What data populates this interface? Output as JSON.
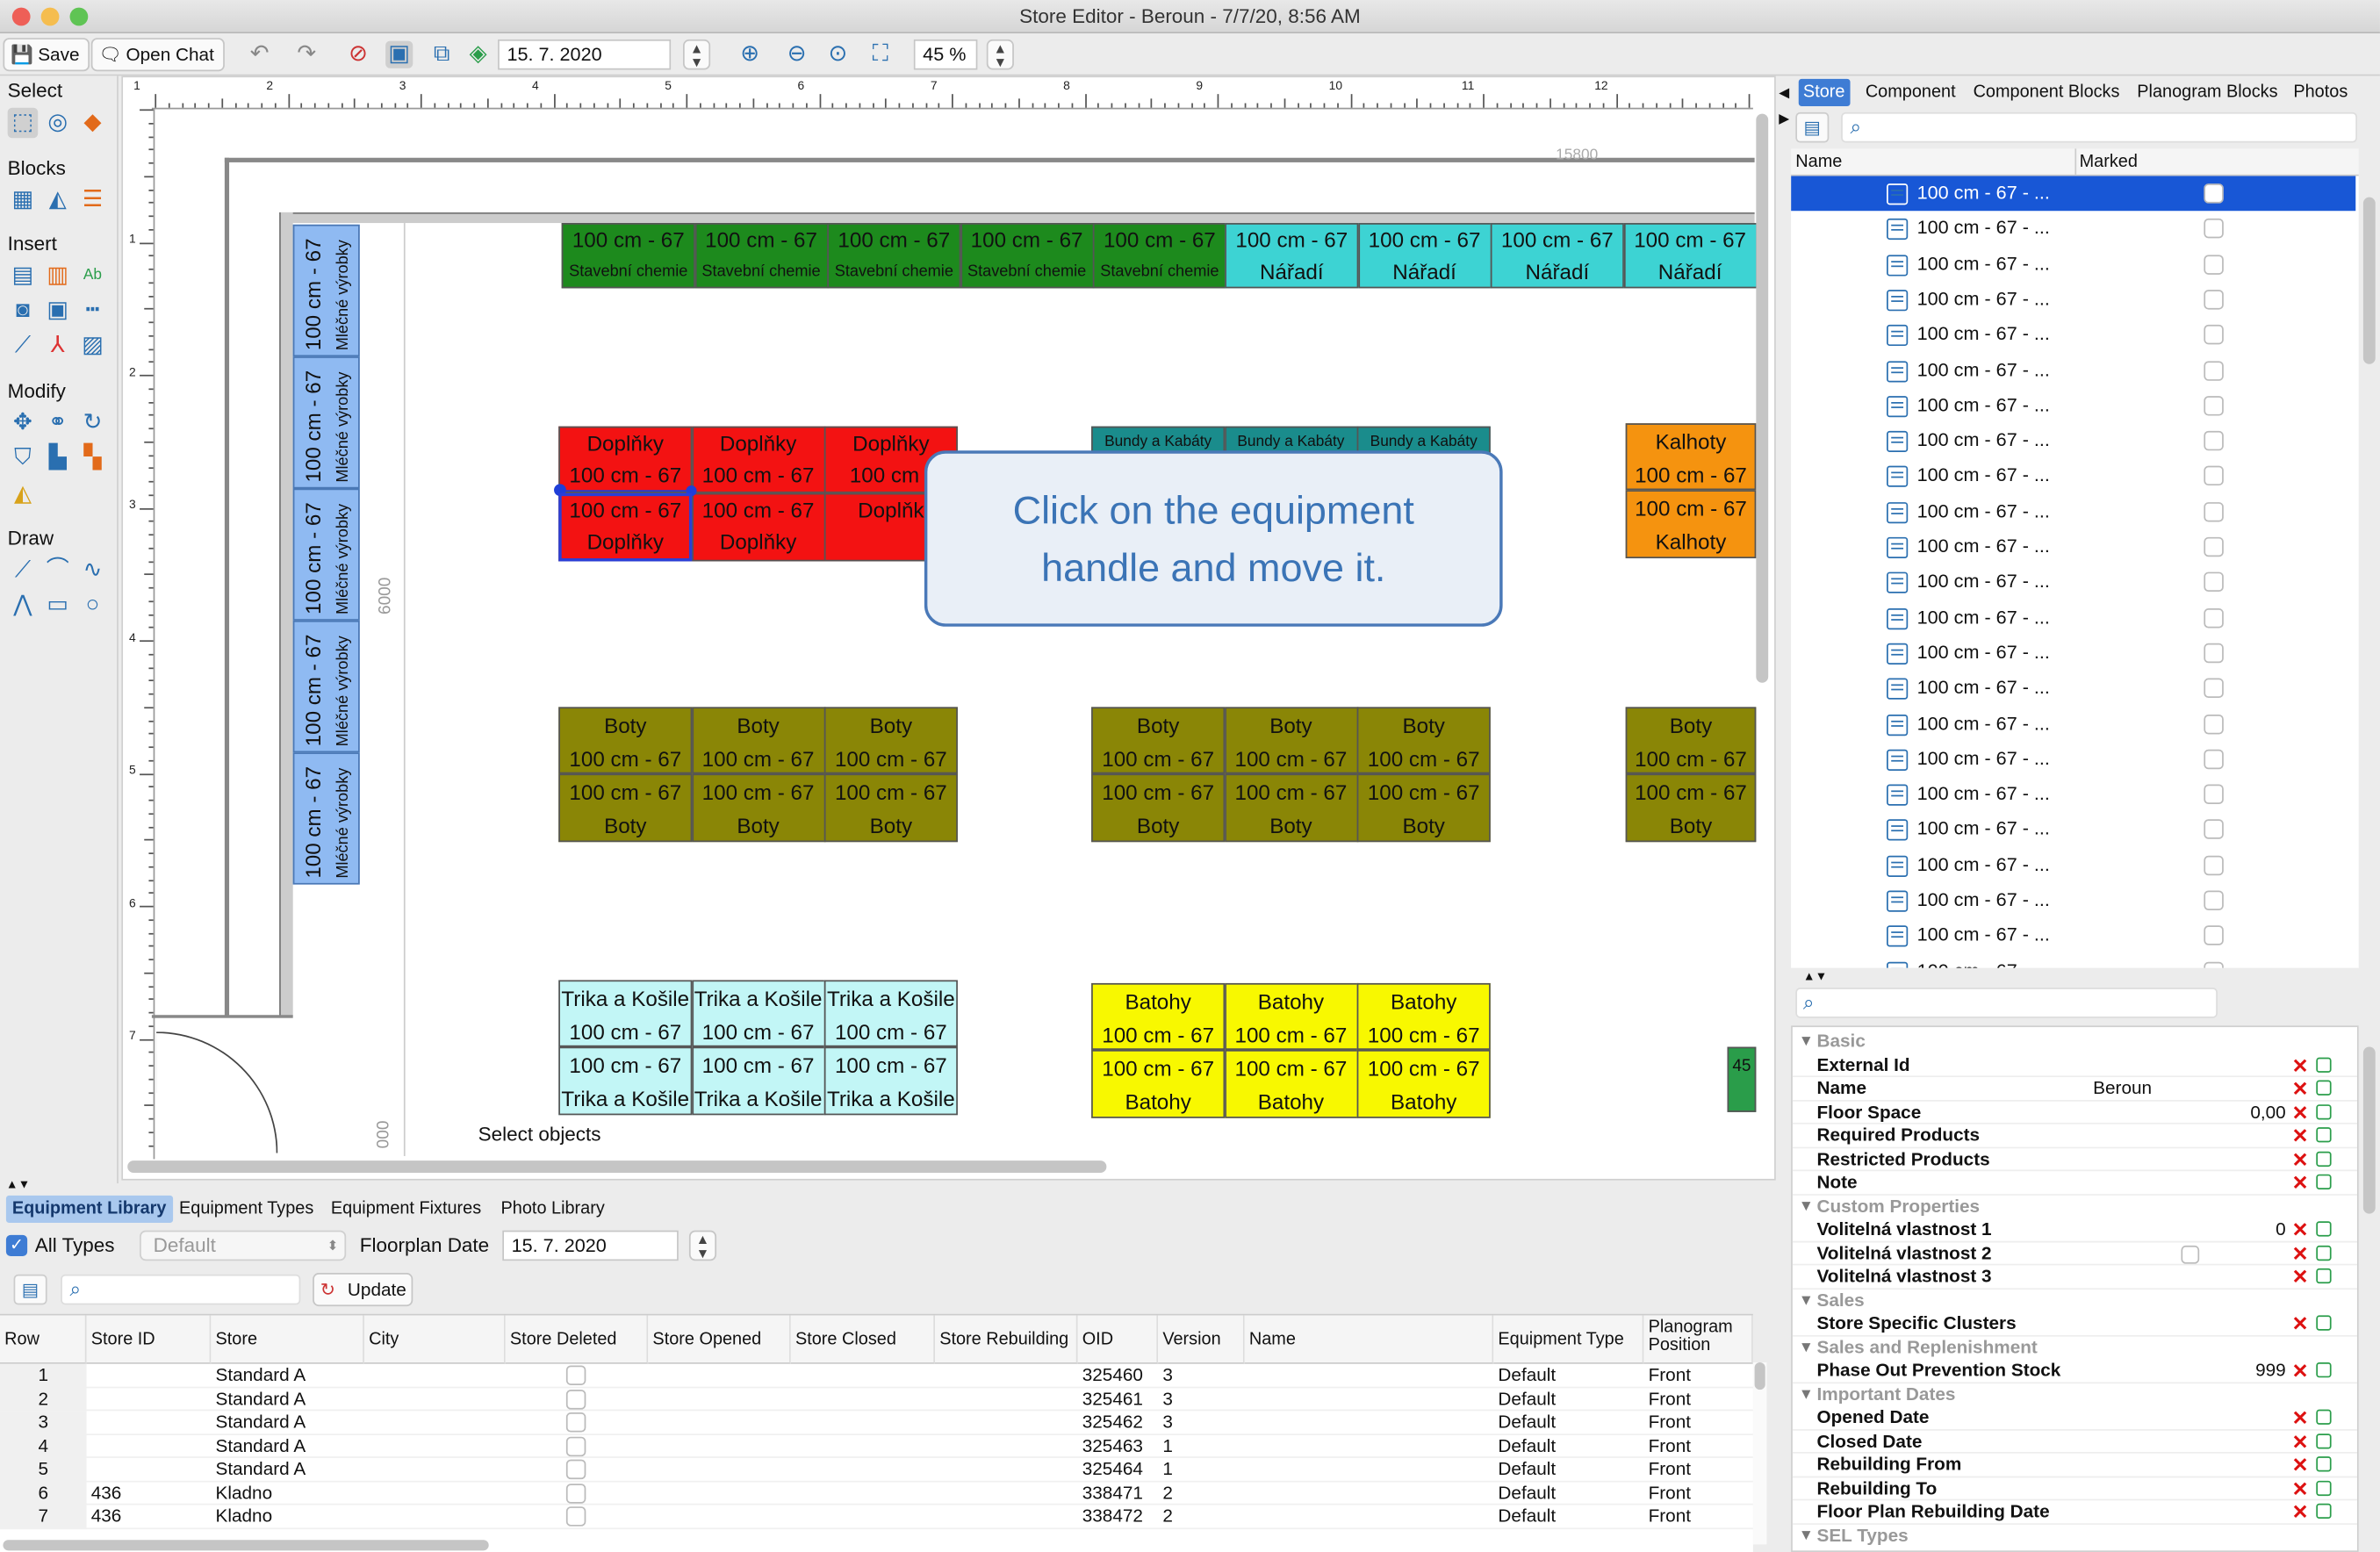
{
  "window": {
    "title": "Store Editor - Beroun - 7/7/20, 8:56 AM"
  },
  "toolbar": {
    "save": "Save",
    "open_chat": "Open Chat",
    "date": "15. 7. 2020",
    "zoom": "45 %"
  },
  "palette": {
    "select": "Select",
    "blocks": "Blocks",
    "insert": "Insert",
    "modify": "Modify",
    "draw": "Draw"
  },
  "canvas": {
    "ruler_numbers": [
      "1",
      "2",
      "3",
      "4",
      "5",
      "6",
      "7",
      "8",
      "9",
      "10",
      "11",
      "12"
    ],
    "ruler_left": [
      "1",
      "2",
      "3",
      "4",
      "5",
      "6",
      "7"
    ],
    "dim_top": "15800",
    "dim_left": "6000",
    "dim_left2": "000",
    "status": "Select objects",
    "milk": [
      "100 cm - 67",
      "Mléčné výrobky"
    ],
    "green": [
      [
        "100 cm - 67",
        "Stavební chemie"
      ],
      [
        "100 cm - 67",
        "Stavební chemie"
      ],
      [
        "100 cm - 67",
        "Stavební chemie"
      ],
      [
        "100 cm - 67",
        "Stavební chemie"
      ],
      [
        "100 cm - 67",
        "Stavební chemie"
      ]
    ],
    "teal": [
      [
        "100 cm - 67",
        "Nářadí"
      ],
      [
        "100 cm - 67",
        "Nářadí"
      ],
      [
        "100 cm - 67",
        "Nářadí"
      ],
      [
        "100 cm - 67",
        "Nářadí"
      ]
    ],
    "red_top": [
      [
        "Doplňky",
        "100 cm - 67"
      ],
      [
        "Doplňky",
        "100 cm - 67"
      ],
      [
        "Doplňky",
        "100 cm -"
      ]
    ],
    "red_bottom": [
      [
        "100 cm - 67",
        "Doplňky"
      ],
      [
        "100 cm - 67",
        "Doplňky"
      ],
      [
        "",
        "Doplňk"
      ]
    ],
    "bundy": [
      "Bundy a Kabáty",
      "Bundy a Kabáty",
      "Bundy a Kabáty"
    ],
    "kalhoty_top": [
      "Kalhoty",
      "100 cm - 67"
    ],
    "kalhoty_bottom": [
      "100 cm - 67",
      "Kalhoty"
    ],
    "boty_label": "Boty",
    "cm": "100 cm - 67",
    "trika": "Trika a Košile",
    "batohy": "Batohy",
    "green_small": "45",
    "callout": [
      "Click on the equipment",
      "handle and move it."
    ]
  },
  "right": {
    "tabs": [
      "Store",
      "Component",
      "Component Blocks",
      "Planogram Blocks",
      "Photos"
    ],
    "col_name": "Name",
    "col_marked": "Marked",
    "item": "100 cm - 67 - ...",
    "basic": "Basic",
    "props": [
      {
        "label": "External Id",
        "value": ""
      },
      {
        "label": "Name",
        "value": "Beroun"
      },
      {
        "label": "Floor Space",
        "value": "0,00"
      },
      {
        "label": "Required Products",
        "value": ""
      },
      {
        "label": "Restricted Products",
        "value": ""
      },
      {
        "label": "Note",
        "value": ""
      }
    ],
    "custom": "Custom Properties",
    "custom_props": [
      {
        "label": "Volitelná vlastnost 1",
        "value": "0"
      },
      {
        "label": "Volitelná vlastnost 2",
        "value": ""
      },
      {
        "label": "Volitelná vlastnost 3",
        "value": ""
      }
    ],
    "sales": "Sales",
    "sales_props": [
      {
        "label": "Store Specific Clusters",
        "value": ""
      }
    ],
    "repl": "Sales and Replenishment",
    "repl_props": [
      {
        "label": "Phase Out Prevention Stock",
        "value": "999"
      }
    ],
    "dates": "Important Dates",
    "date_props": [
      {
        "label": "Opened Date"
      },
      {
        "label": "Closed Date"
      },
      {
        "label": "Rebuilding From"
      },
      {
        "label": "Rebuilding To"
      },
      {
        "label": "Floor Plan Rebuilding Date"
      }
    ],
    "sel": "SEL Types"
  },
  "bottom": {
    "tabs": [
      "Equipment Library",
      "Equipment Types",
      "Equipment Fixtures",
      "Photo Library"
    ],
    "all_types": "All Types",
    "default": "Default",
    "floorplan_date_label": "Floorplan Date",
    "floorplan_date": "15. 7. 2020",
    "update": "Update",
    "columns": [
      "Row",
      "Store ID",
      "Store",
      "City",
      "Store Deleted",
      "Store Opened",
      "Store Closed",
      "Store Rebuilding",
      "OID",
      "Version",
      "Name",
      "Equipment Type",
      "Planogram Position"
    ],
    "rows": [
      [
        "1",
        "",
        "Standard A",
        "",
        "",
        "",
        "",
        "",
        "325460",
        "3",
        "",
        "Default",
        "Front"
      ],
      [
        "2",
        "",
        "Standard A",
        "",
        "",
        "",
        "",
        "",
        "325461",
        "3",
        "",
        "Default",
        "Front"
      ],
      [
        "3",
        "",
        "Standard A",
        "",
        "",
        "",
        "",
        "",
        "325462",
        "3",
        "",
        "Default",
        "Front"
      ],
      [
        "4",
        "",
        "Standard A",
        "",
        "",
        "",
        "",
        "",
        "325463",
        "1",
        "",
        "Default",
        "Front"
      ],
      [
        "5",
        "",
        "Standard A",
        "",
        "",
        "",
        "",
        "",
        "325464",
        "1",
        "",
        "Default",
        "Front"
      ],
      [
        "6",
        "436",
        "Kladno",
        "",
        "",
        "",
        "",
        "",
        "338471",
        "2",
        "",
        "Default",
        "Front"
      ],
      [
        "7",
        "436",
        "Kladno",
        "",
        "",
        "",
        "",
        "",
        "338472",
        "2",
        "",
        "Default",
        "Front"
      ]
    ]
  }
}
